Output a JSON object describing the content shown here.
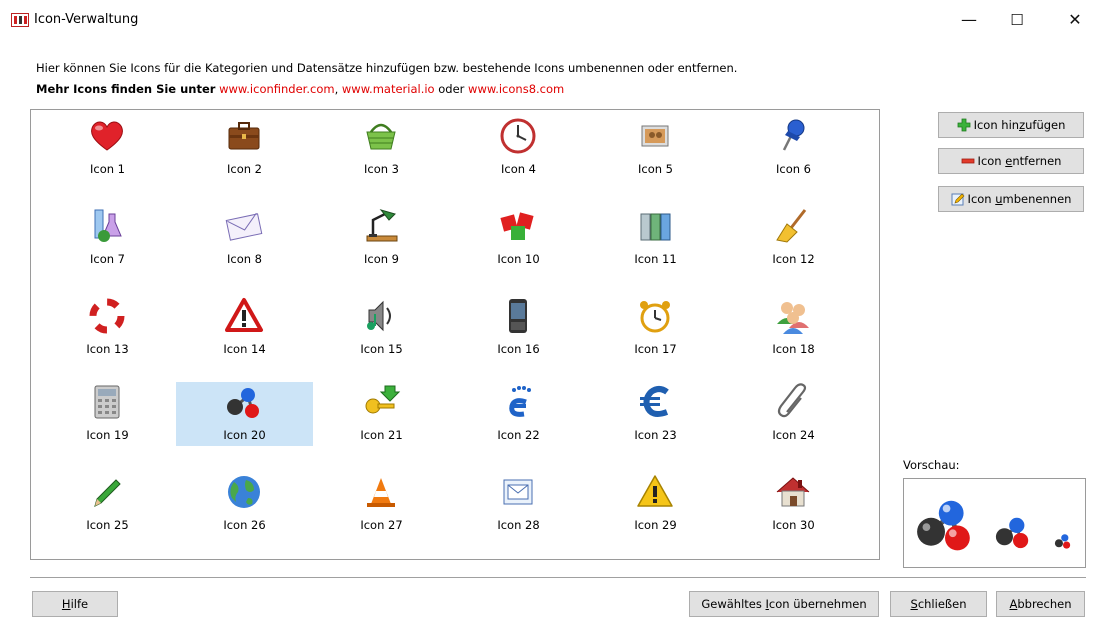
{
  "window": {
    "title": "Icon-Verwaltung",
    "minimize": "—",
    "maximize": "☐",
    "close": "✕"
  },
  "description": "Hier können Sie Icons für die Kategorien und Datensätze hinzufügen bzw. bestehende Icons umbenennen oder entfernen.",
  "more_icons": {
    "prefix": "Mehr Icons finden Sie unter",
    "link1": "www.iconfinder.com",
    "sep1": ",",
    "link2": "www.material.io",
    "sep2": "oder",
    "link3": "www.icons8.com"
  },
  "icons": [
    {
      "label": "Icon 1",
      "icon": "heart-icon"
    },
    {
      "label": "Icon 2",
      "icon": "briefcase-icon"
    },
    {
      "label": "Icon 3",
      "icon": "basket-icon"
    },
    {
      "label": "Icon 4",
      "icon": "clock-icon"
    },
    {
      "label": "Icon 5",
      "icon": "photo-icon"
    },
    {
      "label": "Icon 6",
      "icon": "pushpin-icon"
    },
    {
      "label": "Icon 7",
      "icon": "lab-flask-icon"
    },
    {
      "label": "Icon 8",
      "icon": "envelope-icon"
    },
    {
      "label": "Icon 9",
      "icon": "desk-lamp-icon"
    },
    {
      "label": "Icon 10",
      "icon": "cubes-icon"
    },
    {
      "label": "Icon 11",
      "icon": "binders-icon"
    },
    {
      "label": "Icon 12",
      "icon": "broom-icon"
    },
    {
      "label": "Icon 13",
      "icon": "lifebuoy-icon"
    },
    {
      "label": "Icon 14",
      "icon": "warning-triangle-icon"
    },
    {
      "label": "Icon 15",
      "icon": "speaker-music-icon"
    },
    {
      "label": "Icon 16",
      "icon": "mobile-phone-icon"
    },
    {
      "label": "Icon 17",
      "icon": "alarm-clock-icon"
    },
    {
      "label": "Icon 18",
      "icon": "users-icon"
    },
    {
      "label": "Icon 19",
      "icon": "calculator-icon"
    },
    {
      "label": "Icon 20",
      "icon": "molecule-icon"
    },
    {
      "label": "Icon 21",
      "icon": "key-arrow-icon"
    },
    {
      "label": "Icon 22",
      "icon": "footprint-e-icon"
    },
    {
      "label": "Icon 23",
      "icon": "euro-icon"
    },
    {
      "label": "Icon 24",
      "icon": "paperclip-icon"
    },
    {
      "label": "Icon 25",
      "icon": "pencil-icon"
    },
    {
      "label": "Icon 26",
      "icon": "globe-icon"
    },
    {
      "label": "Icon 27",
      "icon": "traffic-cone-icon"
    },
    {
      "label": "Icon 28",
      "icon": "mail-window-icon"
    },
    {
      "label": "Icon 29",
      "icon": "caution-icon"
    },
    {
      "label": "Icon 30",
      "icon": "house-icon"
    }
  ],
  "selected_index": 19,
  "side_buttons": {
    "add": {
      "pre": "Icon hin",
      "u": "z",
      "post": "ufügen"
    },
    "remove": {
      "pre": "Icon ",
      "u": "e",
      "post": "ntfernen"
    },
    "rename": {
      "pre": "Icon ",
      "u": "u",
      "post": "mbenennen"
    }
  },
  "preview_label": "Vorschau:",
  "buttons": {
    "help": {
      "pre": "",
      "u": "H",
      "post": "ilfe"
    },
    "apply": {
      "pre": "Gewähltes ",
      "u": "I",
      "post": "con übernehmen"
    },
    "close": {
      "pre": "",
      "u": "S",
      "post": "chließen"
    },
    "cancel": {
      "pre": "",
      "u": "A",
      "post": "bbrechen"
    }
  },
  "colors": {
    "link": "#e00000",
    "selection": "#cce4f7"
  }
}
